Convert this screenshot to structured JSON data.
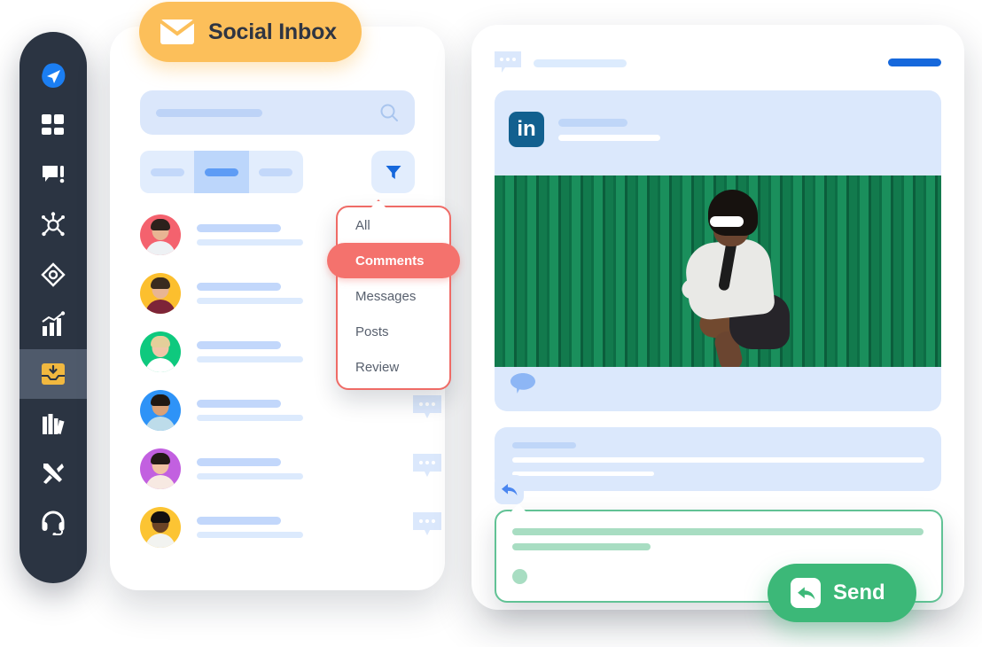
{
  "colors": {
    "sidebar_bg": "#2b3442",
    "sidebar_active_bg": "#4f5a6b",
    "accent_amber": "#fcbf5a",
    "accent_blue": "#1668dc",
    "accent_coral": "#f4726d",
    "accent_green": "#3cb878",
    "placeholder_blue": "#dbe8fc",
    "linkedin_blue": "#12608f"
  },
  "sidebar": {
    "items": [
      {
        "icon": "send-plane-icon",
        "active": false
      },
      {
        "icon": "dashboard-grid-icon",
        "active": false
      },
      {
        "icon": "comment-alert-icon",
        "active": false
      },
      {
        "icon": "network-nodes-icon",
        "active": false
      },
      {
        "icon": "compass-diamond-icon",
        "active": false
      },
      {
        "icon": "analytics-chart-icon",
        "active": false
      },
      {
        "icon": "inbox-download-icon",
        "active": true
      },
      {
        "icon": "library-books-icon",
        "active": false
      },
      {
        "icon": "tools-icon",
        "active": false
      },
      {
        "icon": "headset-support-icon",
        "active": false
      }
    ]
  },
  "inbox": {
    "badge": {
      "label": "Social Inbox",
      "icon": "envelope-icon"
    },
    "search": {
      "placeholder": "",
      "icon": "search-icon"
    },
    "tabs": [
      {
        "label": "",
        "active": false
      },
      {
        "label": "",
        "active": true
      },
      {
        "label": "",
        "active": false
      }
    ],
    "filter_button": {
      "icon": "filter-funnel-icon"
    },
    "conversations": [
      {
        "avatar": "avatar-bearded-man",
        "bg": "#f4626e",
        "hair": "#2c211c",
        "skin": "#e8b593",
        "body": "#eef1f4",
        "has_bubble": false
      },
      {
        "avatar": "avatar-curly-man",
        "bg": "#fcbf2e",
        "hair": "#3a2b1f",
        "skin": "#e8b593",
        "body": "#7d2438",
        "has_bubble": false
      },
      {
        "avatar": "avatar-blonde-woman",
        "bg": "#0ec97e",
        "hair": "#e4cf9a",
        "skin": "#f0c6a8",
        "body": "#ffffff",
        "has_bubble": false
      },
      {
        "avatar": "avatar-smiling-man",
        "bg": "#2e93f7",
        "hair": "#201812",
        "skin": "#d9a177",
        "body": "#bddcea",
        "has_bubble": true
      },
      {
        "avatar": "avatar-asian-woman",
        "bg": "#c260e0",
        "hair": "#241a16",
        "skin": "#f0c2a3",
        "body": "#f7e9e2",
        "has_bubble": true
      },
      {
        "avatar": "avatar-glasses-man",
        "bg": "#fcc433",
        "hair": "#141010",
        "skin": "#6b4326",
        "body": "#f2f3f0",
        "has_bubble": true
      }
    ]
  },
  "dropdown": {
    "items": [
      {
        "label": "All",
        "selected": false
      },
      {
        "label": "Comments",
        "selected": true
      },
      {
        "label": "Messages",
        "selected": false
      },
      {
        "label": "Posts",
        "selected": false
      },
      {
        "label": "Review",
        "selected": false
      }
    ]
  },
  "post": {
    "header": {
      "icon": "comment-dots-icon"
    },
    "network": {
      "name": "in",
      "icon": "linkedin-icon"
    },
    "photo": {
      "alt": "woman-in-sunglasses-green-wall",
      "background": "green-corrugated-wall"
    },
    "footer": {
      "icon": "speech-bubble-icon"
    },
    "comment": {},
    "reply": {
      "button_icon": "reply-arrow-icon",
      "composer_placeholder": ""
    },
    "send": {
      "label": "Send",
      "icon": "reply-arrow-icon"
    }
  }
}
